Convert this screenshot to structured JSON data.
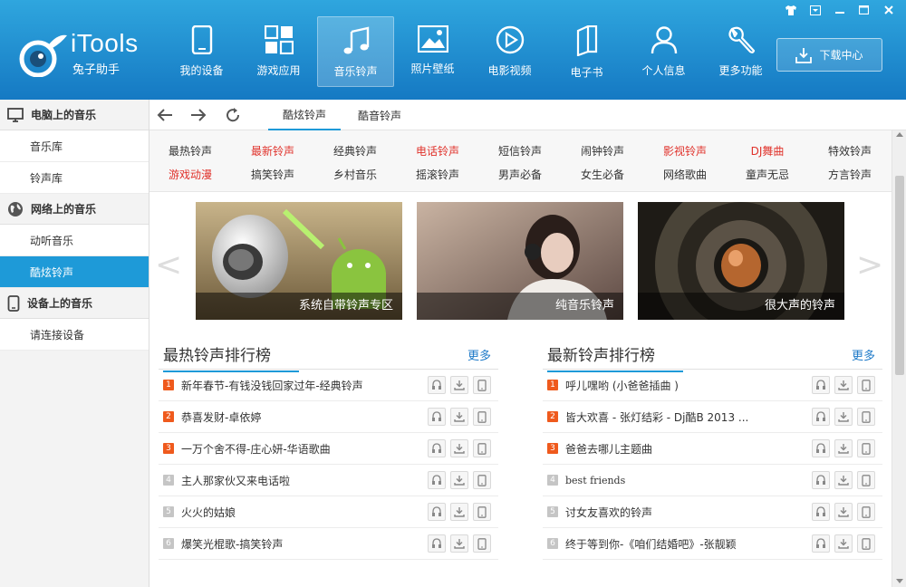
{
  "app": {
    "logo_title": "iTools",
    "logo_subtitle": "兔子助手"
  },
  "nav": [
    {
      "label": "我的设备",
      "icon": "phone-icon"
    },
    {
      "label": "游戏应用",
      "icon": "apps-grid-icon"
    },
    {
      "label": "音乐铃声",
      "icon": "music-note-icon",
      "active": true
    },
    {
      "label": "照片壁纸",
      "icon": "picture-icon"
    },
    {
      "label": "电影视频",
      "icon": "play-icon"
    },
    {
      "label": "电子书",
      "icon": "book-icon"
    },
    {
      "label": "个人信息",
      "icon": "user-icon"
    },
    {
      "label": "更多功能",
      "icon": "wrench-icon"
    }
  ],
  "download_center": "下载中心",
  "sidebar": {
    "groups": [
      {
        "label": "电脑上的音乐",
        "icon": "monitor-icon",
        "items": [
          "音乐库",
          "铃声库"
        ]
      },
      {
        "label": "网络上的音乐",
        "icon": "globe-icon",
        "items": [
          "动听音乐",
          "酷炫铃声"
        ]
      },
      {
        "label": "设备上的音乐",
        "icon": "device-icon",
        "items": [
          "请连接设备"
        ]
      }
    ],
    "active_item": "酷炫铃声"
  },
  "toolbar": {
    "tabs": [
      "酷炫铃声",
      "酷音铃声"
    ],
    "active_tab": "酷炫铃声"
  },
  "categories": {
    "row1": [
      {
        "label": "最热铃声",
        "red": false
      },
      {
        "label": "最新铃声",
        "red": true
      },
      {
        "label": "经典铃声",
        "red": false
      },
      {
        "label": "电话铃声",
        "red": true
      },
      {
        "label": "短信铃声",
        "red": false
      },
      {
        "label": "闹钟铃声",
        "red": false
      },
      {
        "label": "影视铃声",
        "red": true
      },
      {
        "label": "DJ舞曲",
        "red": true
      },
      {
        "label": "特效铃声",
        "red": false
      }
    ],
    "row2": [
      {
        "label": "游戏动漫",
        "red": true
      },
      {
        "label": "搞笑铃声",
        "red": false
      },
      {
        "label": "乡村音乐",
        "red": false
      },
      {
        "label": "摇滚铃声",
        "red": false
      },
      {
        "label": "男声必备",
        "red": false
      },
      {
        "label": "女生必备",
        "red": false
      },
      {
        "label": "网络歌曲",
        "red": false
      },
      {
        "label": "童声无忌",
        "red": false
      },
      {
        "label": "方言铃声",
        "red": false
      }
    ],
    "accent_red": "#e0322b"
  },
  "banners": [
    {
      "caption": "系统自带铃声专区"
    },
    {
      "caption": "纯音乐铃声"
    },
    {
      "caption": "很大声的铃声"
    }
  ],
  "hot_list": {
    "title": "最热铃声排行榜",
    "more": "更多",
    "items": [
      {
        "rank": "1",
        "name": "新年春节-有钱没钱回家过年-经典铃声"
      },
      {
        "rank": "2",
        "name": "恭喜发财-卓依婷"
      },
      {
        "rank": "3",
        "name": "一万个舍不得-庄心妍-华语歌曲"
      },
      {
        "rank": "4",
        "name": "主人那家伙又来电话啦"
      },
      {
        "rank": "5",
        "name": "火火的姑娘"
      },
      {
        "rank": "6",
        "name": "爆笑光棍歌-搞笑铃声"
      }
    ]
  },
  "new_list": {
    "title": "最新铃声排行榜",
    "more": "更多",
    "items": [
      {
        "rank": "1",
        "name": "呼儿嘿哟 (小爸爸插曲 )"
      },
      {
        "rank": "2",
        "name": "皆大欢喜 - 张灯结彩 - Dj酷B 2013 ..."
      },
      {
        "rank": "3",
        "name": "爸爸去哪儿主题曲"
      },
      {
        "rank": "4",
        "name": "best friends"
      },
      {
        "rank": "5",
        "name": "讨女友喜欢的铃声"
      },
      {
        "rank": "6",
        "name": "终于等到你-《咱们结婚吧》-张靓颖"
      }
    ]
  },
  "colors": {
    "brand_blue": "#1e9ad8",
    "rank_top": "#ef5a1d",
    "rank_normal": "#c5c5c5"
  }
}
